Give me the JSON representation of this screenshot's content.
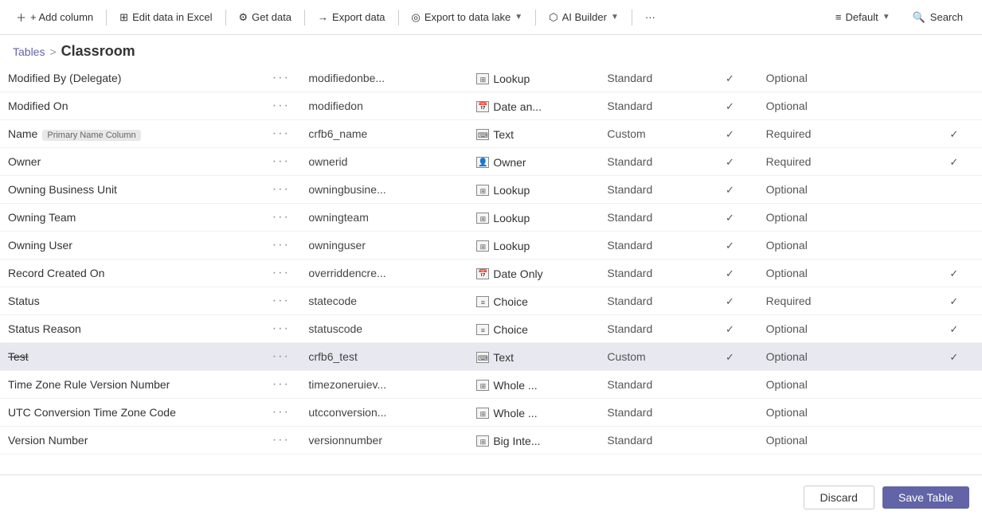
{
  "toolbar": {
    "add_column": "+ Add column",
    "edit_excel": "Edit data in Excel",
    "get_data": "Get data",
    "export_data": "Export data",
    "export_lake": "Export to data lake",
    "ai_builder": "AI Builder",
    "more": "···",
    "default": "Default",
    "search": "Search"
  },
  "breadcrumb": {
    "tables": "Tables",
    "separator": ">",
    "current": "Classroom"
  },
  "rows": [
    {
      "name": "Modified By (Delegate)",
      "logicalname": "modifiedonbe...",
      "type_icon": "Lookup",
      "type_col": "Standard",
      "check1": true,
      "req": "Optional",
      "check2": false,
      "selected": false,
      "strikethrough": false,
      "primary": false
    },
    {
      "name": "Modified On",
      "logicalname": "modifiedon",
      "type_icon": "Date an...",
      "type_col": "Standard",
      "check1": true,
      "req": "Optional",
      "check2": false,
      "selected": false,
      "strikethrough": false,
      "primary": false
    },
    {
      "name": "Name",
      "logicalname": "crfb6_name",
      "type_icon": "Text",
      "type_col": "Custom",
      "check1": true,
      "req": "Required",
      "check2": true,
      "selected": false,
      "strikethrough": false,
      "primary": true
    },
    {
      "name": "Owner",
      "logicalname": "ownerid",
      "type_icon": "Owner",
      "type_col": "Standard",
      "check1": true,
      "req": "Required",
      "check2": true,
      "selected": false,
      "strikethrough": false,
      "primary": false
    },
    {
      "name": "Owning Business Unit",
      "logicalname": "owningbusine...",
      "type_icon": "Lookup",
      "type_col": "Standard",
      "check1": true,
      "req": "Optional",
      "check2": false,
      "selected": false,
      "strikethrough": false,
      "primary": false
    },
    {
      "name": "Owning Team",
      "logicalname": "owningteam",
      "type_icon": "Lookup",
      "type_col": "Standard",
      "check1": true,
      "req": "Optional",
      "check2": false,
      "selected": false,
      "strikethrough": false,
      "primary": false
    },
    {
      "name": "Owning User",
      "logicalname": "owninguser",
      "type_icon": "Lookup",
      "type_col": "Standard",
      "check1": true,
      "req": "Optional",
      "check2": false,
      "selected": false,
      "strikethrough": false,
      "primary": false
    },
    {
      "name": "Record Created On",
      "logicalname": "overriddencre...",
      "type_icon": "Date Only",
      "type_col": "Standard",
      "check1": true,
      "req": "Optional",
      "check2": true,
      "selected": false,
      "strikethrough": false,
      "primary": false
    },
    {
      "name": "Status",
      "logicalname": "statecode",
      "type_icon": "Choice",
      "type_col": "Standard",
      "check1": true,
      "req": "Required",
      "check2": true,
      "selected": false,
      "strikethrough": false,
      "primary": false
    },
    {
      "name": "Status Reason",
      "logicalname": "statuscode",
      "type_icon": "Choice",
      "type_col": "Standard",
      "check1": true,
      "req": "Optional",
      "check2": true,
      "selected": false,
      "strikethrough": false,
      "primary": false
    },
    {
      "name": "Test",
      "logicalname": "crfb6_test",
      "type_icon": "Text",
      "type_col": "Custom",
      "check1": true,
      "req": "Optional",
      "check2": true,
      "selected": true,
      "strikethrough": true,
      "primary": false
    },
    {
      "name": "Time Zone Rule Version Number",
      "logicalname": "timezoneruiev...",
      "type_icon": "Whole ...",
      "type_col": "Standard",
      "check1": false,
      "req": "Optional",
      "check2": false,
      "selected": false,
      "strikethrough": false,
      "primary": false
    },
    {
      "name": "UTC Conversion Time Zone Code",
      "logicalname": "utcconversion...",
      "type_icon": "Whole ...",
      "type_col": "Standard",
      "check1": false,
      "req": "Optional",
      "check2": false,
      "selected": false,
      "strikethrough": false,
      "primary": false
    },
    {
      "name": "Version Number",
      "logicalname": "versionnumber",
      "type_icon": "Big Inte...",
      "type_col": "Standard",
      "check1": false,
      "req": "Optional",
      "check2": false,
      "selected": false,
      "strikethrough": false,
      "primary": false
    }
  ],
  "type_icons": {
    "Lookup": "⊞",
    "Date an...": "📅",
    "Text": "⌨",
    "Owner": "👤",
    "Date Only": "📅",
    "Choice": "≡",
    "Whole ...": "⊞",
    "Big Inte...": "⊞"
  },
  "footer": {
    "discard": "Discard",
    "save": "Save Table"
  }
}
